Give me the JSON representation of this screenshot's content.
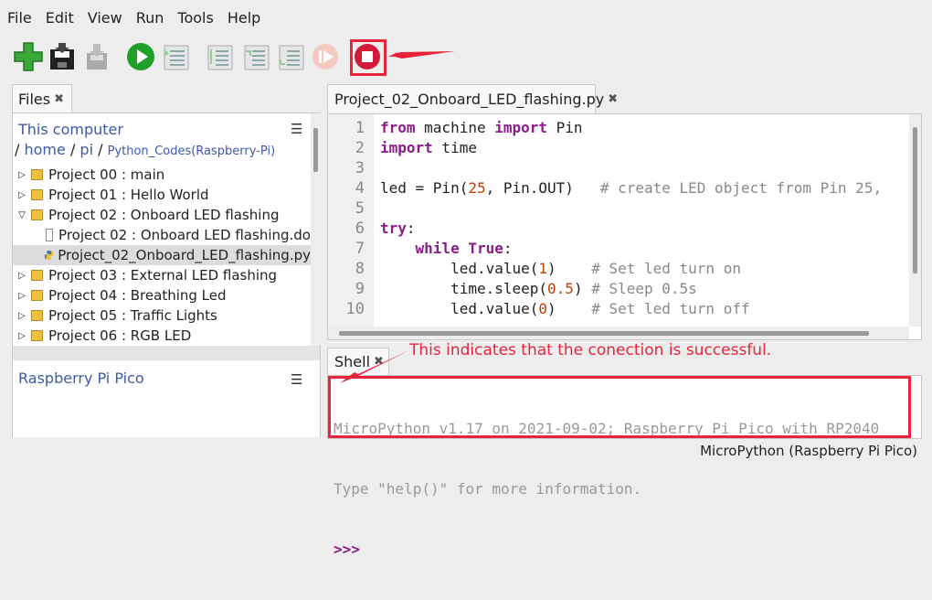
{
  "menubar": {
    "items": [
      "File",
      "Edit",
      "View",
      "Run",
      "Tools",
      "Help"
    ]
  },
  "toolbar": {
    "buttons": [
      "new-file",
      "save",
      "load",
      "run",
      "debug",
      "step-over",
      "step-into",
      "step-out",
      "resume",
      "stop"
    ],
    "highlighted": "stop",
    "accent_color": "#e8233a"
  },
  "files": {
    "tab_label": "Files",
    "computer_label": "This computer",
    "path": {
      "sep": "/",
      "home": "home",
      "pi": "pi",
      "folder": "Python_Codes(Raspberry-Pi)"
    },
    "tree": [
      {
        "label": "Project 00 : main",
        "type": "folder",
        "expanded": false,
        "level": 0
      },
      {
        "label": "Project 01 : Hello World",
        "type": "folder",
        "expanded": false,
        "level": 0
      },
      {
        "label": "Project 02 : Onboard LED flashing",
        "type": "folder",
        "expanded": true,
        "level": 0
      },
      {
        "label": "Project 02 : Onboard LED flashing.do",
        "type": "file",
        "level": 1
      },
      {
        "label": "Project_02_Onboard_LED_flashing.py",
        "type": "python",
        "level": 1,
        "selected": true
      },
      {
        "label": "Project 03 : External LED flashing",
        "type": "folder",
        "expanded": false,
        "level": 0
      },
      {
        "label": "Project 04 : Breathing Led",
        "type": "folder",
        "expanded": false,
        "level": 0
      },
      {
        "label": "Project 05 : Traffic Lights",
        "type": "folder",
        "expanded": false,
        "level": 0
      },
      {
        "label": "Project 06 : RGB LED",
        "type": "folder",
        "expanded": false,
        "level": 0
      }
    ],
    "device_label": "Raspberry Pi Pico"
  },
  "editor": {
    "tab_label": "Project_02_Onboard_LED_flashing.py",
    "line_numbers": [
      "1",
      "2",
      "3",
      "4",
      "5",
      "6",
      "7",
      "8",
      "9",
      "10"
    ],
    "lines": [
      {
        "indent": "",
        "tokens": [
          {
            "t": "kw",
            "v": "from"
          },
          {
            "t": "",
            "v": " machine "
          },
          {
            "t": "kw",
            "v": "import"
          },
          {
            "t": "",
            "v": " Pin"
          }
        ]
      },
      {
        "indent": "",
        "tokens": [
          {
            "t": "kw",
            "v": "import"
          },
          {
            "t": "",
            "v": " time"
          }
        ]
      },
      {
        "indent": "",
        "tokens": []
      },
      {
        "indent": "",
        "tokens": [
          {
            "t": "",
            "v": "led = Pin("
          },
          {
            "t": "num",
            "v": "25"
          },
          {
            "t": "",
            "v": ", Pin.OUT)   "
          },
          {
            "t": "cm",
            "v": "# create LED object from Pin 25,"
          }
        ]
      },
      {
        "indent": "",
        "tokens": []
      },
      {
        "indent": "",
        "tokens": [
          {
            "t": "kw",
            "v": "try"
          },
          {
            "t": "",
            "v": ":"
          }
        ]
      },
      {
        "indent": "    ",
        "tokens": [
          {
            "t": "kw",
            "v": "while"
          },
          {
            "t": "",
            "v": " "
          },
          {
            "t": "kw",
            "v": "True"
          },
          {
            "t": "",
            "v": ":"
          }
        ]
      },
      {
        "indent": "        ",
        "tokens": [
          {
            "t": "",
            "v": "led.value("
          },
          {
            "t": "num",
            "v": "1"
          },
          {
            "t": "",
            "v": ")    "
          },
          {
            "t": "cm",
            "v": "# Set led turn on"
          }
        ]
      },
      {
        "indent": "        ",
        "tokens": [
          {
            "t": "",
            "v": "time.sleep("
          },
          {
            "t": "num",
            "v": "0.5"
          },
          {
            "t": "",
            "v": ") "
          },
          {
            "t": "cm",
            "v": "# Sleep 0.5s"
          }
        ]
      },
      {
        "indent": "        ",
        "tokens": [
          {
            "t": "",
            "v": "led.value("
          },
          {
            "t": "num",
            "v": "0"
          },
          {
            "t": "",
            "v": ")    "
          },
          {
            "t": "cm",
            "v": "# Set led turn off"
          }
        ]
      }
    ]
  },
  "shell": {
    "tab_label": "Shell",
    "output_line1": "MicroPython v1.17 on 2021-09-02; Raspberry Pi Pico with RP2040",
    "output_line2": "Type \"help()\" for more information.",
    "prompt": ">>>"
  },
  "annotation": {
    "text": "This indicates that the conection is successful."
  },
  "status_bar": {
    "interpreter": "MicroPython (Raspberry Pi Pico)"
  }
}
